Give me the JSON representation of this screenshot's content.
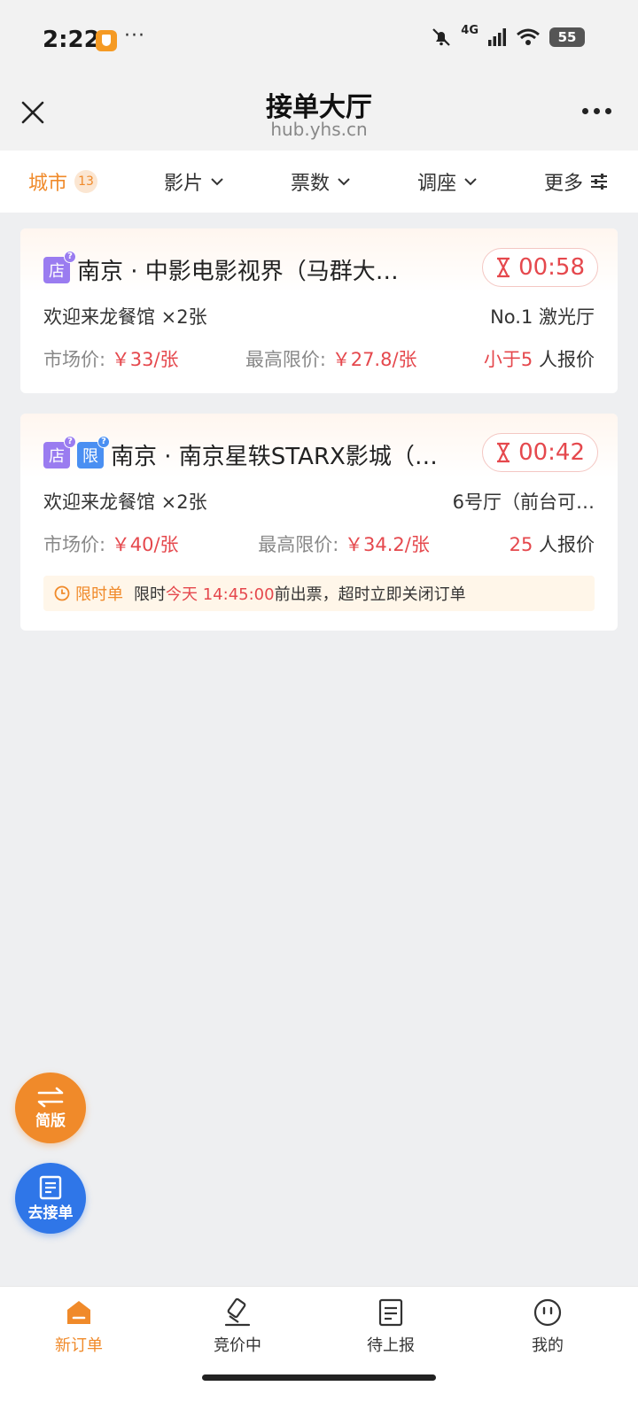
{
  "status_bar": {
    "time": "2:22",
    "dots": "···",
    "network": "4G",
    "battery": "55"
  },
  "nav": {
    "title": "接单大厅",
    "subtitle": "hub.yhs.cn",
    "close_icon": "close-icon",
    "more_icon": "more-dots-icon"
  },
  "filters": [
    {
      "label": "城市",
      "badge": "13",
      "active": true
    },
    {
      "label": "影片",
      "icon": "chevron-down-icon"
    },
    {
      "label": "票数",
      "icon": "chevron-down-icon"
    },
    {
      "label": "调座",
      "icon": "chevron-down-icon"
    },
    {
      "label": "更多",
      "icon": "sliders-icon"
    }
  ],
  "orders": [
    {
      "tags": [
        "店"
      ],
      "tag_hint": "?",
      "cinema": "南京 · 中影电影视界（马群大…",
      "timer": "00:58",
      "movie": "欢迎来龙餐馆 ×2张",
      "hall": "No.1 激光厅",
      "market_label": "市场价:",
      "market_price": "￥33/张",
      "max_label": "最高限价:",
      "max_price": "￥27.8/张",
      "quote_count": "小于5",
      "quote_suffix": "人报价"
    },
    {
      "tags": [
        "店",
        "限"
      ],
      "tag_hint": "?",
      "cinema": "南京 · 南京星轶STARX影城（…",
      "timer": "00:42",
      "movie": "欢迎来龙餐馆 ×2张",
      "hall": "6号厅（前台可…",
      "market_label": "市场价:",
      "market_price": "￥40/张",
      "max_label": "最高限价:",
      "max_price": "￥34.2/张",
      "quote_count": "25",
      "quote_suffix": "人报价",
      "notice": {
        "label": "限时单",
        "prefix": "限时",
        "deadline": "今天 14:45:00",
        "suffix": "前出票，超时立即关闭订单"
      }
    }
  ],
  "fabs": {
    "simple": "简版",
    "go_orders": "去接单"
  },
  "tabs": [
    {
      "label": "新订单",
      "icon": "home-icon",
      "active": true
    },
    {
      "label": "竞价中",
      "icon": "gavel-icon"
    },
    {
      "label": "待上报",
      "icon": "document-icon"
    },
    {
      "label": "我的",
      "icon": "profile-icon"
    }
  ],
  "colors": {
    "accent": "#f08a2a",
    "price_red": "#e5484d",
    "store_tag": "#9a7cf0",
    "limit_tag": "#4a8ff2",
    "fab_blue": "#2f76e8"
  }
}
